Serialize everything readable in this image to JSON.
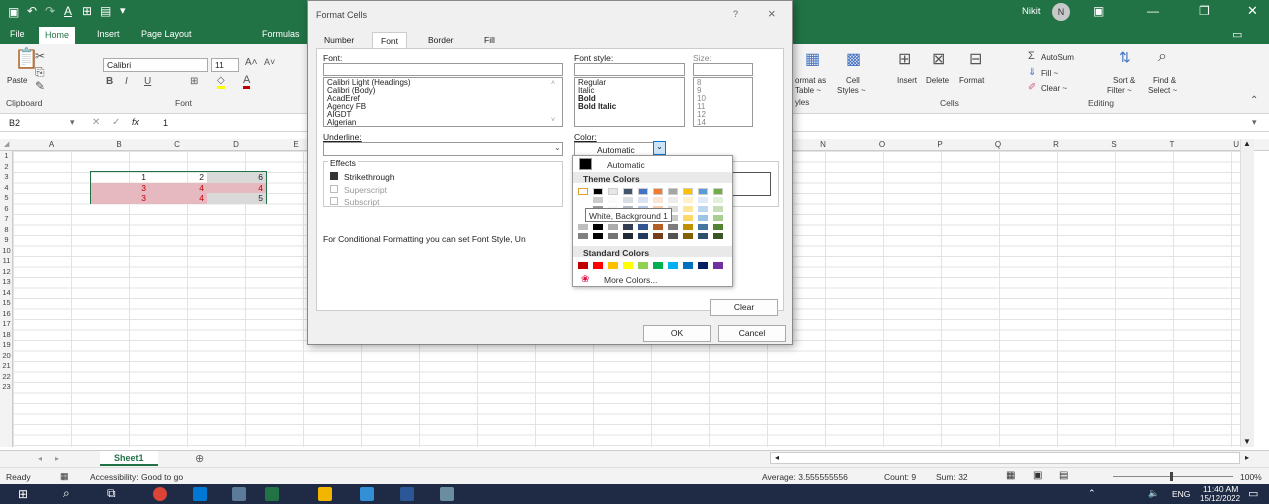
{
  "title_bar": {
    "user": "Nikit",
    "initial": "N"
  },
  "ribbon_tabs": [
    "File",
    "Home",
    "Insert",
    "Page Layout",
    "Formulas"
  ],
  "ribbon": {
    "paste": "Paste",
    "clipboard": "Clipboard",
    "font_group": "Font",
    "font_name": "Calibri",
    "font_size": "11",
    "styles": {
      "format_as": "ormat as",
      "table": "Table ~",
      "ables": "yles",
      "cell": "Cell",
      "cell_styles": "Styles ~"
    },
    "cells": {
      "insert": "Insert",
      "delete": "Delete",
      "format": "Format",
      "label": "Cells"
    },
    "editing": {
      "autosum": "AutoSum",
      "fill": "Fill ~",
      "clear": "Clear ~",
      "sort": "Sort &",
      "filter": "Filter ~",
      "find": "Find &",
      "select": "Select ~",
      "label": "Editing"
    }
  },
  "formula_bar": {
    "name_box": "B2",
    "fx": "fx",
    "value": "1"
  },
  "columns_left": [
    "A",
    "B",
    "C",
    "D",
    "E"
  ],
  "columns_right": [
    "N",
    "O",
    "P",
    "Q",
    "R",
    "S",
    "T",
    "U"
  ],
  "rows": [
    "1",
    "2",
    "3",
    "4",
    "5",
    "6",
    "7",
    "8",
    "9",
    "10",
    "11",
    "12",
    "13",
    "14",
    "15",
    "16",
    "17",
    "18",
    "19",
    "20",
    "21",
    "22",
    "23"
  ],
  "cells": [
    [
      "1",
      "2",
      "6"
    ],
    [
      "3",
      "4",
      "4"
    ],
    [
      "3",
      "4",
      "5"
    ]
  ],
  "sheet": {
    "name": "Sheet1",
    "add": "⊕"
  },
  "status": {
    "ready": "Ready",
    "accessibility": "Accessibility: Good to go",
    "average": "Average: 3.555555556",
    "count": "Count: 9",
    "sum": "Sum: 32",
    "zoom": "100%"
  },
  "taskbar": {
    "lang": "ENG",
    "time": "11:40 AM",
    "date": "15/12/2022"
  },
  "dialog": {
    "title": "Format Cells",
    "help": "?",
    "close": "×",
    "tabs": [
      "Number",
      "Font",
      "Border",
      "Fill"
    ],
    "font_label": "Font:",
    "font_style_label": "Font style:",
    "size_label": "Size:",
    "fonts": [
      "Calibri Light (Headings)",
      "Calibri (Body)",
      "AcadEref",
      "Agency FB",
      "AIGDT",
      "Algerian"
    ],
    "styles": [
      "Regular",
      "Italic",
      "Bold",
      "Bold Italic"
    ],
    "sizes": [
      "8",
      "9",
      "10",
      "11",
      "12",
      "14"
    ],
    "underline_label": "Underline:",
    "color_label": "Color:",
    "color_value": "Automatic",
    "effects_label": "Effects",
    "strikethrough": "Strikethrough",
    "superscript": "Superscript",
    "subscript": "Subscript",
    "note": "For Conditional Formatting you can set Font Style, Un",
    "clear": "Clear",
    "ok": "OK",
    "cancel": "Cancel"
  },
  "color_popup": {
    "automatic": "Automatic",
    "theme_colors": "Theme Colors",
    "tooltip": "White, Background 1",
    "standard_colors": "Standard Colors",
    "more_colors": "More Colors...",
    "theme_top": [
      "#ffffff",
      "#000000",
      "#e7e6e6",
      "#44546a",
      "#4472c4",
      "#ed7d31",
      "#a5a5a5",
      "#ffc000",
      "#5b9bd5",
      "#70ad47"
    ],
    "standard": [
      "#c00000",
      "#ff0000",
      "#ffc000",
      "#ffff00",
      "#92d050",
      "#00b050",
      "#00b0f0",
      "#0070c0",
      "#002060",
      "#7030a0"
    ]
  }
}
